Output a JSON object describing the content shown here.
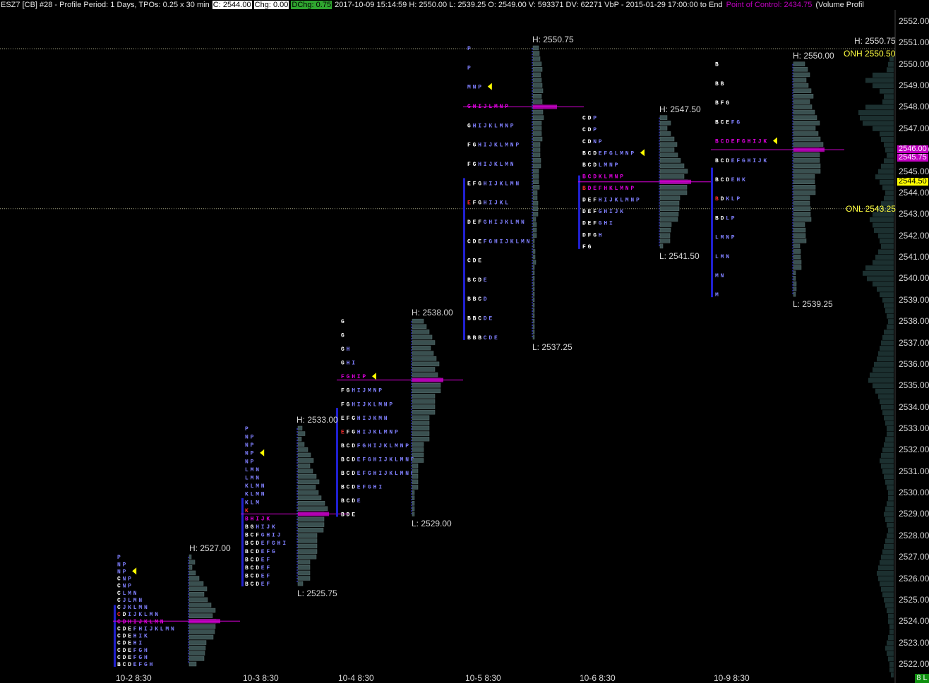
{
  "header": {
    "symbol": "ESZ7 [CB]  #28 - Profile Period: 1 Days, TPOs: 0.25 x 30 min",
    "close": "C: 2544.00",
    "change": "Chg: 0.00",
    "dchange": "DChg: 0.75",
    "info": "2017-10-09 15:14:59  H: 2550.00  L: 2539.25  O: 2549.00  V: 593371  DV: 62271  VbP - 2015-01-29  17:00:00 to End",
    "poc": "Point of Control: 2434.75",
    "volume_profile": "(Volume Profil"
  },
  "price_axis": {
    "min": 2521.75,
    "max": 2552.25,
    "labels": [
      "2552.00",
      "2551.00",
      "2550.00",
      "2549.00",
      "2548.00",
      "2547.00",
      "2546.00",
      "2545.00",
      "2544.00",
      "2543.00",
      "2542.00",
      "2541.00",
      "2540.00",
      "2539.00",
      "2538.00",
      "2537.00",
      "2536.00",
      "2535.00",
      "2534.00",
      "2533.00",
      "2532.00",
      "2531.00",
      "2530.00",
      "2529.00",
      "2528.00",
      "2527.00",
      "2526.00",
      "2525.00",
      "2524.00",
      "2523.00",
      "2522.00"
    ],
    "current_price": "2544.50",
    "poc_tag_1": "2546.00",
    "poc_tag_2": "2545.75",
    "corner_label": "8 L"
  },
  "reference_lines": {
    "onh_label": "ONH  2550.50",
    "onh_price": 2550.5,
    "onl_label": "ONL  2543.25",
    "onl_price": 2543.25,
    "h_top_label": "H: 2550.75"
  },
  "colors": {
    "tpo_white": "#ffffff",
    "tpo_blue": "#8080ff",
    "poc_magenta": "#e000e0",
    "volume_bar": "#3a5050",
    "opening_range": "#2020d0",
    "marker_yellow": "#ffff00",
    "ref_line": "#c0c0a0"
  },
  "sessions": [
    {
      "date": "10-2  8:30",
      "high_label": "H: 2527.00",
      "low_label": "",
      "high": 2527.0,
      "low": 2522.0,
      "poc": 2524.0
    },
    {
      "date": "10-3  8:30",
      "high_label": "H: 2533.00",
      "low_label": "L: 2525.75",
      "high": 2533.0,
      "low": 2525.75,
      "poc": 2529.0
    },
    {
      "date": "10-4  8:30",
      "high_label": "H: 2538.00",
      "low_label": "L: 2529.00",
      "high": 2538.0,
      "low": 2529.0,
      "poc": 2535.25
    },
    {
      "date": "10-5  8:30",
      "high_label": "H: 2550.75",
      "low_label": "L: 2537.25",
      "high": 2550.75,
      "low": 2537.25,
      "poc": 2548.0
    },
    {
      "date": "10-6  8:30",
      "high_label": "H: 2547.50",
      "low_label": "L: 2541.50",
      "high": 2547.5,
      "low": 2541.5,
      "poc": 2544.5
    },
    {
      "date": "10-9  8:30",
      "high_label": "H: 2550.00",
      "low_label": "L: 2539.25",
      "high": 2550.0,
      "low": 2539.25,
      "poc": 2546.0
    }
  ],
  "tpo_columns": {
    "s1": [
      "BCDEFGH",
      "CDEFGH",
      "CDEFGH",
      "CDEHI",
      "CDEHIK",
      "CDEFHIJKLMN",
      "CDHIJKLMN",
      "CDIJKLMN",
      "CJKLMN",
      "CJLMN",
      "CLMN",
      "CNP",
      "CNP",
      "NP",
      "NP",
      "P"
    ],
    "s2": [
      "BCDEF",
      "BCDEF",
      "BCDEF",
      "BCDEF",
      "BCDEFG",
      "BCDEFGHI",
      "BCFGHIJ",
      "BGHIJK",
      "BHIJK",
      "K",
      "KLM",
      "KLMN",
      "KLMN",
      "LMN",
      "LMN",
      "NP",
      "NP",
      "NP",
      "NP",
      "P"
    ],
    "s3": [
      "BDE",
      "BCDE",
      "BCDEFGHI",
      "BCDEFGHIJKLMNP",
      "BCDEFGHIJKLMNP",
      "BCDFGHIJKLMNP",
      "EFGHIJKLMNP",
      "EFGHIJKMN",
      "FGHIJKLMNP",
      "FGHIJMNP",
      "FGHIP",
      "GHI",
      "GH",
      "G",
      "G"
    ],
    "s4": [
      "BBBCDE",
      "BBCDE",
      "BBCD",
      "BCDE",
      "CDE",
      "CDEFGHIJKLMN",
      "DEFGHIJKLMN",
      "EFGHIJKL",
      "EFGHIJKLMN",
      "FGHIJKLMN",
      "FGHIJKLMNP",
      "GHIJKLMNP",
      "GHIJLMNP",
      "MNP",
      "P",
      "P"
    ],
    "s5": [
      "FG",
      "DFGH",
      "DEFGHI",
      "DEFGHIJK",
      "DEFHIJKLMNP",
      "BDEFHKLMNP",
      "BCDKLMNP",
      "BCDLMNP",
      "BCDEFGLMNP",
      "CDNP",
      "CDP",
      "CDP"
    ],
    "s6": [
      "M",
      "MN",
      "LMN",
      "LMNP",
      "BDLP",
      "BDKLP",
      "BCDEHK",
      "BCDEFGHIJK",
      "BCDEFGHIJK",
      "BCEFG",
      "BFG",
      "BB",
      "B"
    ]
  }
}
